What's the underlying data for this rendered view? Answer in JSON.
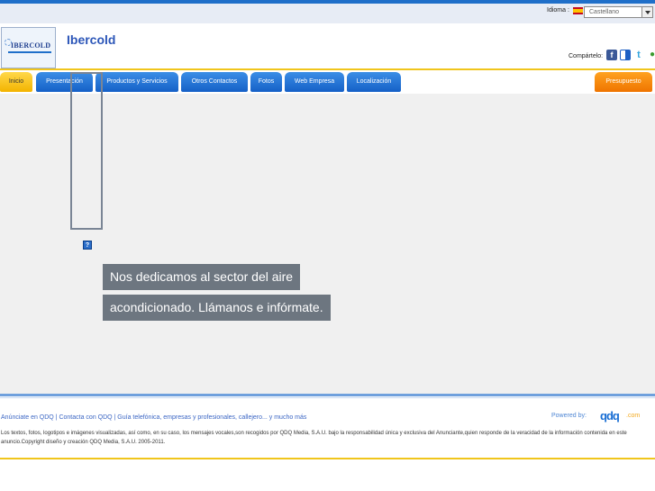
{
  "topbar": {
    "language_label": "Idioma :",
    "language_selected": "Castellano"
  },
  "header": {
    "site_title": "Ibercold",
    "logo_text": "IBERCOLD",
    "share_label": "Compártelo:"
  },
  "nav": {
    "tabs": [
      {
        "label": "Inicio"
      },
      {
        "label": "Presentación"
      },
      {
        "label": "Productos y Servicios"
      },
      {
        "label": "Otros Contactos"
      },
      {
        "label": "Fotos"
      },
      {
        "label": "Web Empresa"
      },
      {
        "label": "Localización"
      }
    ],
    "quote_label": "Presupuesto"
  },
  "main": {
    "caption_line1": "Nos dedicamos al sector del aire",
    "caption_line2": "acondicionado. Llámanos e infórmate.",
    "broken_image_glyph": "?"
  },
  "footer": {
    "links": "Anúnciate en QDQ | Contacta con QDQ | Guía telefónica, empresas y profesionales, callejero... y mucho más",
    "powered_by": "Powered by:",
    "brand": "qdq",
    "brand_suffix": ".com",
    "legal": "Los textos, fotos, logotipos e imágenes visualizadas, así como, en su caso, los mensajes vocales,son recogidos por QDQ Media, S.A.U. bajo la responsabilidad única y exclusiva del Anunciante,quien responde de la veracidad de la información contenida en este anuncio.Copyright diseño y creación QDQ Media, S.A.U. 2005-2011."
  },
  "colors": {
    "nav_blue": "#1f6fc9",
    "active_tab": "#f3b400",
    "quote_tab": "#ef7400",
    "caption_bg": "#6d7680"
  },
  "icons": [
    "spain-flag-icon",
    "facebook-icon",
    "delicious-icon",
    "twitter-icon",
    "google-buzz-icon",
    "broken-image-icon"
  ]
}
